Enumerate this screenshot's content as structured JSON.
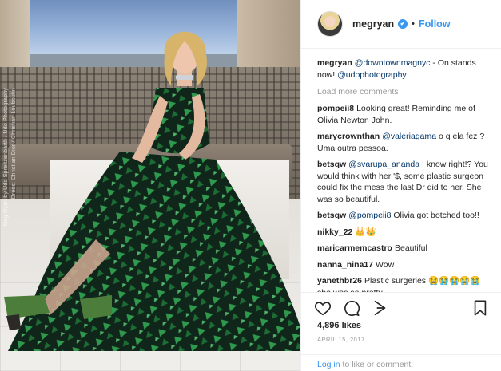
{
  "photo": {
    "alt_credit_1": "Meg Ryan by Udo Spreitzenbarth / Udo Photography",
    "alt_credit_2": "Dress: Christian Dior / Christian Louboutin"
  },
  "header": {
    "username": "megryan",
    "verified_mark": "✔",
    "separator": "•",
    "follow_label": "Follow"
  },
  "caption": {
    "user": "megryan",
    "mention": "@downtownmagnyc",
    "text": " - On stands now! ",
    "mention2": "@udophotography"
  },
  "load_more_label": "Load more comments",
  "comments": [
    {
      "user": "pompeii8",
      "text": "Looking great! Reminding me of Olivia Newton John."
    },
    {
      "user": "marycrownthan",
      "mention": "@valeriagama",
      "text": " o q ela fez ? Uma outra pessoa."
    },
    {
      "user": "betsqw",
      "mention": "@svarupa_ananda",
      "text": " I know right!? You would think with her '$, some plastic surgeon could fix the mess the last Dr did to her. She was so beautiful."
    },
    {
      "user": "betsqw",
      "mention": "@pompeii8",
      "text": " Olivia got botched too!!"
    },
    {
      "user": "nikky_22",
      "text": "👑👑"
    },
    {
      "user": "maricarmemcastro",
      "text": "Beautiful"
    },
    {
      "user": "nanna_nina17",
      "text": "Wow"
    },
    {
      "user": "yanethbr26",
      "text": "Plastic surgeries 😭😭😭😭😭 she was so pretty"
    }
  ],
  "likes_label": "4,896 likes",
  "date_label": "APRIL 15, 2017",
  "footer": {
    "login_link": "Log in",
    "rest": " to like or comment."
  },
  "icons": {
    "like": "heart-icon",
    "comment": "comment-icon",
    "share": "share-icon",
    "save": "bookmark-icon"
  },
  "colors": {
    "link_blue": "#3897f0",
    "mention_blue": "#003569",
    "muted_gray": "#999999",
    "dress_green": "#1f7a3c"
  }
}
